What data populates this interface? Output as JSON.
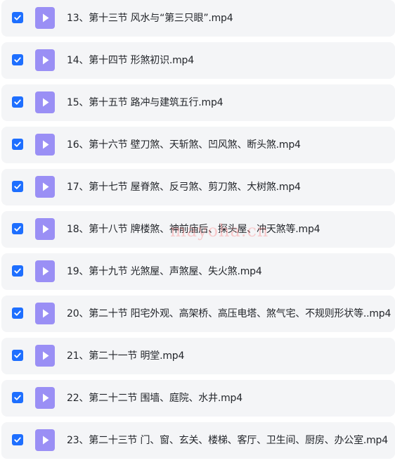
{
  "colors": {
    "row_background": "#f4f5f7",
    "checkbox_accent": "#1e6fff",
    "video_icon": "#9a8ff5",
    "text": "#23262b",
    "watermark": "#ff7878"
  },
  "files": [
    {
      "name": "13、第十三节 风水与“第三只眼”.mp4",
      "checked": true,
      "icon": "video-file-icon"
    },
    {
      "name": "14、第十四节 形煞初识.mp4",
      "checked": true,
      "icon": "video-file-icon"
    },
    {
      "name": "15、第十五节 路冲与建筑五行.mp4",
      "checked": true,
      "icon": "video-file-icon"
    },
    {
      "name": "16、第十六节 壁刀煞、天斩煞、凹风煞、断头煞.mp4",
      "checked": true,
      "icon": "video-file-icon"
    },
    {
      "name": "17、第十七节 屋脊煞、反弓煞、剪刀煞、大树煞.mp4",
      "checked": true,
      "icon": "video-file-icon"
    },
    {
      "name": "18、第十八节 牌楼煞、神前庙后、探头屋、冲天煞等.mp4",
      "checked": true,
      "icon": "video-file-icon"
    },
    {
      "name": "19、第十九节 光煞屋、声煞屋、失火煞.mp4",
      "checked": true,
      "icon": "video-file-icon"
    },
    {
      "name": "20、第二十节 阳宅外观、高架桥、高压电塔、煞气宅、不规则形状等..mp4",
      "checked": true,
      "icon": "video-file-icon"
    },
    {
      "name": "21、第二十一节 明堂.mp4",
      "checked": true,
      "icon": "video-file-icon"
    },
    {
      "name": "22、第二十二节 围墙、庭院、水井.mp4",
      "checked": true,
      "icon": "video-file-icon"
    },
    {
      "name": "23、第二十三节 门、窗、玄关、楼梯、客厅、卫生间、厨房、办公室.mp4",
      "checked": true,
      "icon": "video-file-icon"
    }
  ],
  "watermark": "mayoha.cn"
}
